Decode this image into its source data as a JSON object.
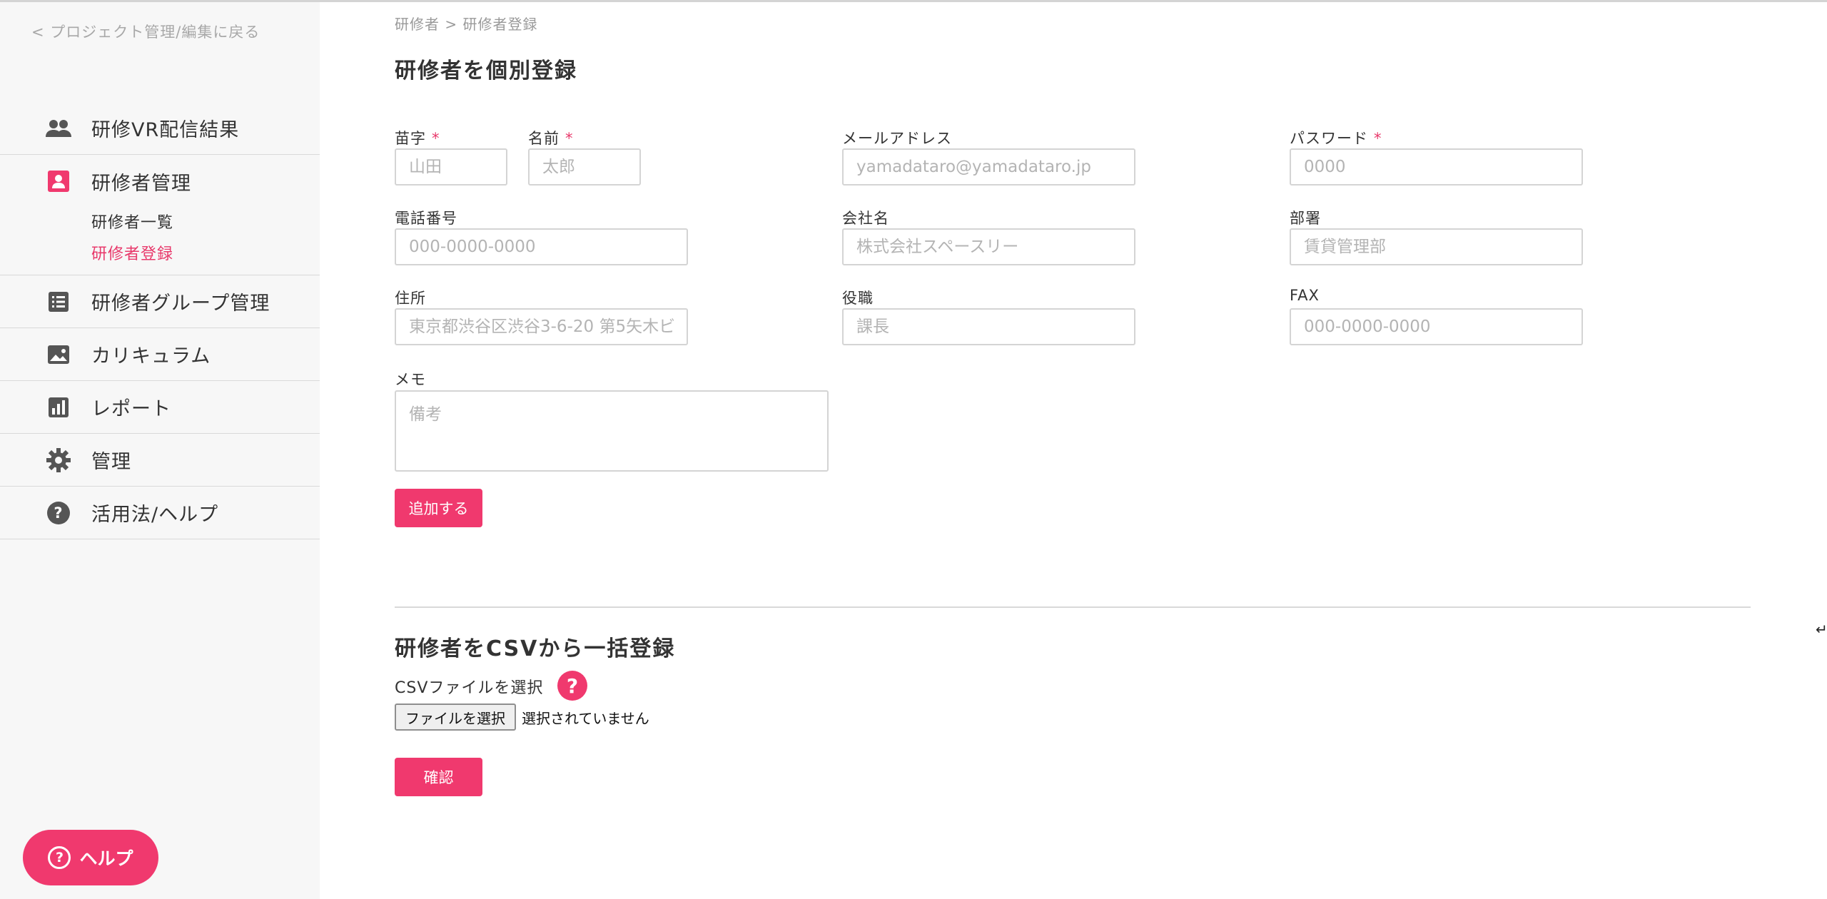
{
  "sidebar": {
    "back_link": "< プロジェクト管理/編集に戻る",
    "items": [
      {
        "label": "研修VR配信結果",
        "icon": "users-icon"
      },
      {
        "label": "研修者管理",
        "icon": "user-card-icon"
      },
      {
        "label": "研修者グループ管理",
        "icon": "list-icon"
      },
      {
        "label": "カリキュラム",
        "icon": "image-icon"
      },
      {
        "label": "レポート",
        "icon": "bar-chart-icon"
      },
      {
        "label": "管理",
        "icon": "gear-icon"
      },
      {
        "label": "活用法/ヘルプ",
        "icon": "question-icon"
      }
    ],
    "subitems": [
      {
        "label": "研修者一覧"
      },
      {
        "label": "研修者登録"
      }
    ],
    "help_button": "ヘルプ"
  },
  "breadcrumb": "研修者 > 研修者登録",
  "form": {
    "title": "研修者を個別登録",
    "required_mark": "*",
    "last_name": {
      "label": "苗字",
      "placeholder": "山田"
    },
    "first_name": {
      "label": "名前",
      "placeholder": "太郎"
    },
    "email": {
      "label": "メールアドレス",
      "placeholder": "yamadataro@yamadataro.jp"
    },
    "password": {
      "label": "パスワード",
      "placeholder": "0000"
    },
    "phone": {
      "label": "電話番号",
      "placeholder": "000-0000-0000"
    },
    "company": {
      "label": "会社名",
      "placeholder": "株式会社スペースリー"
    },
    "department": {
      "label": "部署",
      "placeholder": "賃貸管理部"
    },
    "address": {
      "label": "住所",
      "placeholder": "東京都渋谷区渋谷3-6-20 第5矢木ビ"
    },
    "position": {
      "label": "役職",
      "placeholder": "課長"
    },
    "fax": {
      "label": "FAX",
      "placeholder": "000-0000-0000"
    },
    "memo": {
      "label": "メモ",
      "placeholder": "備考"
    },
    "submit": "追加する"
  },
  "csv": {
    "title": "研修者をCSVから一括登録",
    "select_label": "CSVファイルを選択",
    "help_mark": "?",
    "file_button": "ファイルを選択",
    "file_status": "選択されていません",
    "confirm": "確認"
  },
  "colors": {
    "accent": "#f0396e",
    "sidebar_bg": "#f7f7f7"
  }
}
